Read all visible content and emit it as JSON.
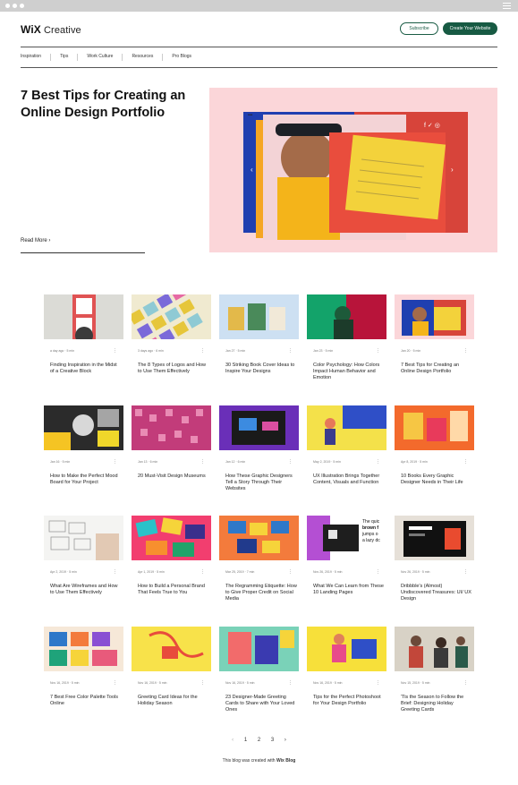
{
  "brand": {
    "name_bold": "WiX",
    "name_rest": "Creative"
  },
  "header": {
    "subscribe": "Subscribe",
    "cta": "Create Your Website"
  },
  "nav": [
    "Inspiration",
    "Tips",
    "Work Culture",
    "Resources",
    "Pro Blogs"
  ],
  "hero": {
    "title": "7 Best Tips for Creating an Online Design Portfolio",
    "read_more": "Read More"
  },
  "posts": [
    {
      "meta": "a day ago  ·  5 min",
      "title": "Finding Inspiration in the Midst of a Creative Block"
    },
    {
      "meta": "3 days ago  ·  6 min",
      "title": "The 8 Types of Logos and How to Use Them Effectively"
    },
    {
      "meta": "Jan 27  ·  5 min",
      "title": "30 Striking Book Cover Ideas to Inspire Your Designs"
    },
    {
      "meta": "Jan 23  ·  5 min",
      "title": "Color Psychology: How Colors Impact Human Behavior and Emotion"
    },
    {
      "meta": "Jan 20  ·  5 min",
      "title": "7 Best Tips for Creating an Online Design Portfolio"
    },
    {
      "meta": "Jan 16  ·  5 min",
      "title": "How to Make the Perfect Mood Board for Your Project"
    },
    {
      "meta": "Jan 13  ·  6 min",
      "title": "20 Must-Visit Design Museums"
    },
    {
      "meta": "Jan 12  ·  6 min",
      "title": "How These Graphic Designers Tell a Story Through Their Websites"
    },
    {
      "meta": "May 2, 2019  ·  5 min",
      "title": "UX Illustration Brings Together Content, Visuals and Function"
    },
    {
      "meta": "Apr 8, 2019  ·  5 min",
      "title": "10 Books Every Graphic Designer Needs in Their Life"
    },
    {
      "meta": "Apr 2, 2019  ·  5 min",
      "title": "What Are Wireframes and How to Use Them Effectively"
    },
    {
      "meta": "Apr 1, 2019  ·  5 min",
      "title": "How to Build a Personal Brand That Feels True to You"
    },
    {
      "meta": "Mar 25, 2019  ·  7 min",
      "title": "The Regramming Etiquette: How to Give Proper Credit on Social Media"
    },
    {
      "meta": "Nov 26, 2019  ·  5 min",
      "title": "What We Can Learn from These 10 Landing Pages"
    },
    {
      "meta": "Nov 26, 2019  ·  5 min",
      "title": "Dribbble's (Almost) Undiscovered Treasures: UI/ UX Design"
    },
    {
      "meta": "Nov 16, 2019  ·  5 min",
      "title": "7 Best Free Color Palette Tools Online"
    },
    {
      "meta": "Nov 16, 2019  ·  5 min",
      "title": "Greeting Card Ideas for the Holiday Season"
    },
    {
      "meta": "Nov 16, 2019  ·  5 min",
      "title": "23 Designer-Made Greeting Cards to Share with Your Loved Ones"
    },
    {
      "meta": "Nov 16, 2019  ·  5 min",
      "title": "Tips for the Perfect Photoshoot for Your Design Portfolio"
    },
    {
      "meta": "Nov 15, 2019  ·  5 min",
      "title": "'Tis the Season to Follow the Brief: Designing Holiday Greeting Cards"
    }
  ],
  "pagination": {
    "prev": "‹",
    "p1": "1",
    "p2": "2",
    "p3": "3",
    "next": "›"
  },
  "footer": {
    "text": "This blog was created with",
    "brand": "Wix Blog"
  }
}
